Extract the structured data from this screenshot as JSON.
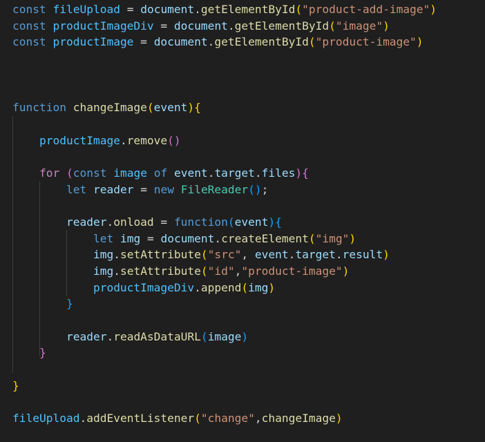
{
  "colors": {
    "background": "#1f1f1f",
    "keyword": "#569cd6",
    "control_keyword": "#c586c0",
    "constant_variable": "#4fc1ff",
    "variable": "#9cdcfe",
    "function": "#dcdcaa",
    "string": "#ce9178",
    "class": "#4ec9b0",
    "bracket_1": "#ffd700",
    "bracket_2": "#da70d6",
    "bracket_3": "#179fff"
  },
  "code": {
    "lines": [
      [
        {
          "t": "const",
          "c": "kw"
        },
        {
          "t": " ",
          "c": "op"
        },
        {
          "t": "fileUpload",
          "c": "var"
        },
        {
          "t": " = ",
          "c": "op"
        },
        {
          "t": "document",
          "c": "prop"
        },
        {
          "t": ".",
          "c": "op"
        },
        {
          "t": "getElementById",
          "c": "fn"
        },
        {
          "t": "(",
          "c": "br1"
        },
        {
          "t": "\"product-add-image\"",
          "c": "str"
        },
        {
          "t": ")",
          "c": "br1"
        }
      ],
      [
        {
          "t": "const",
          "c": "kw"
        },
        {
          "t": " ",
          "c": "op"
        },
        {
          "t": "productImageDiv",
          "c": "var"
        },
        {
          "t": " = ",
          "c": "op"
        },
        {
          "t": "document",
          "c": "prop"
        },
        {
          "t": ".",
          "c": "op"
        },
        {
          "t": "getElementById",
          "c": "fn"
        },
        {
          "t": "(",
          "c": "br1"
        },
        {
          "t": "\"image\"",
          "c": "str"
        },
        {
          "t": ")",
          "c": "br1"
        }
      ],
      [
        {
          "t": "const",
          "c": "kw"
        },
        {
          "t": " ",
          "c": "op"
        },
        {
          "t": "productImage",
          "c": "var"
        },
        {
          "t": " = ",
          "c": "op"
        },
        {
          "t": "document",
          "c": "prop"
        },
        {
          "t": ".",
          "c": "op"
        },
        {
          "t": "getElementById",
          "c": "fn"
        },
        {
          "t": "(",
          "c": "br1"
        },
        {
          "t": "\"product-image\"",
          "c": "str"
        },
        {
          "t": ")",
          "c": "br1"
        }
      ],
      [],
      [],
      [],
      [
        {
          "t": "function",
          "c": "kw"
        },
        {
          "t": " ",
          "c": "op"
        },
        {
          "t": "changeImage",
          "c": "fn"
        },
        {
          "t": "(",
          "c": "br1"
        },
        {
          "t": "event",
          "c": "prop"
        },
        {
          "t": ")",
          "c": "br1"
        },
        {
          "t": "{",
          "c": "br1"
        }
      ],
      [],
      [
        {
          "t": "    ",
          "c": "op"
        },
        {
          "t": "productImage",
          "c": "var"
        },
        {
          "t": ".",
          "c": "op"
        },
        {
          "t": "remove",
          "c": "fn"
        },
        {
          "t": "()",
          "c": "br2"
        }
      ],
      [],
      [
        {
          "t": "    ",
          "c": "op"
        },
        {
          "t": "for",
          "c": "kw2"
        },
        {
          "t": " ",
          "c": "op"
        },
        {
          "t": "(",
          "c": "br2"
        },
        {
          "t": "const",
          "c": "kw"
        },
        {
          "t": " ",
          "c": "op"
        },
        {
          "t": "image",
          "c": "var"
        },
        {
          "t": " ",
          "c": "op"
        },
        {
          "t": "of",
          "c": "kw"
        },
        {
          "t": " ",
          "c": "op"
        },
        {
          "t": "event",
          "c": "prop"
        },
        {
          "t": ".",
          "c": "op"
        },
        {
          "t": "target",
          "c": "prop"
        },
        {
          "t": ".",
          "c": "op"
        },
        {
          "t": "files",
          "c": "prop"
        },
        {
          "t": ")",
          "c": "br2"
        },
        {
          "t": "{",
          "c": "br2"
        }
      ],
      [
        {
          "t": "        ",
          "c": "op"
        },
        {
          "t": "let",
          "c": "kw"
        },
        {
          "t": " ",
          "c": "op"
        },
        {
          "t": "reader",
          "c": "prop"
        },
        {
          "t": " = ",
          "c": "op"
        },
        {
          "t": "new",
          "c": "kw"
        },
        {
          "t": " ",
          "c": "op"
        },
        {
          "t": "FileReader",
          "c": "cls"
        },
        {
          "t": "()",
          "c": "br3"
        },
        {
          "t": ";",
          "c": "op"
        }
      ],
      [],
      [
        {
          "t": "        ",
          "c": "op"
        },
        {
          "t": "reader",
          "c": "prop"
        },
        {
          "t": ".",
          "c": "op"
        },
        {
          "t": "onload",
          "c": "fn"
        },
        {
          "t": " = ",
          "c": "op"
        },
        {
          "t": "function",
          "c": "kw"
        },
        {
          "t": "(",
          "c": "br3"
        },
        {
          "t": "event",
          "c": "prop"
        },
        {
          "t": ")",
          "c": "br3"
        },
        {
          "t": "{",
          "c": "br3"
        }
      ],
      [
        {
          "t": "            ",
          "c": "op"
        },
        {
          "t": "let",
          "c": "kw"
        },
        {
          "t": " ",
          "c": "op"
        },
        {
          "t": "img",
          "c": "prop"
        },
        {
          "t": " = ",
          "c": "op"
        },
        {
          "t": "document",
          "c": "prop"
        },
        {
          "t": ".",
          "c": "op"
        },
        {
          "t": "createElement",
          "c": "fn"
        },
        {
          "t": "(",
          "c": "br1"
        },
        {
          "t": "\"img\"",
          "c": "str"
        },
        {
          "t": ")",
          "c": "br1"
        }
      ],
      [
        {
          "t": "            ",
          "c": "op"
        },
        {
          "t": "img",
          "c": "prop"
        },
        {
          "t": ".",
          "c": "op"
        },
        {
          "t": "setAttribute",
          "c": "fn"
        },
        {
          "t": "(",
          "c": "br1"
        },
        {
          "t": "\"src\"",
          "c": "str"
        },
        {
          "t": ", ",
          "c": "op"
        },
        {
          "t": "event",
          "c": "prop"
        },
        {
          "t": ".",
          "c": "op"
        },
        {
          "t": "target",
          "c": "prop"
        },
        {
          "t": ".",
          "c": "op"
        },
        {
          "t": "result",
          "c": "prop"
        },
        {
          "t": ")",
          "c": "br1"
        }
      ],
      [
        {
          "t": "            ",
          "c": "op"
        },
        {
          "t": "img",
          "c": "prop"
        },
        {
          "t": ".",
          "c": "op"
        },
        {
          "t": "setAttribute",
          "c": "fn"
        },
        {
          "t": "(",
          "c": "br1"
        },
        {
          "t": "\"id\"",
          "c": "str"
        },
        {
          "t": ",",
          "c": "op"
        },
        {
          "t": "\"product-image\"",
          "c": "str"
        },
        {
          "t": ")",
          "c": "br1"
        }
      ],
      [
        {
          "t": "            ",
          "c": "op"
        },
        {
          "t": "productImageDiv",
          "c": "var"
        },
        {
          "t": ".",
          "c": "op"
        },
        {
          "t": "append",
          "c": "fn"
        },
        {
          "t": "(",
          "c": "br1"
        },
        {
          "t": "img",
          "c": "prop"
        },
        {
          "t": ")",
          "c": "br1"
        }
      ],
      [
        {
          "t": "        ",
          "c": "op"
        },
        {
          "t": "}",
          "c": "br3"
        }
      ],
      [],
      [
        {
          "t": "        ",
          "c": "op"
        },
        {
          "t": "reader",
          "c": "prop"
        },
        {
          "t": ".",
          "c": "op"
        },
        {
          "t": "readAsDataURL",
          "c": "fn"
        },
        {
          "t": "(",
          "c": "br3"
        },
        {
          "t": "image",
          "c": "prop"
        },
        {
          "t": ")",
          "c": "br3"
        }
      ],
      [
        {
          "t": "    ",
          "c": "op"
        },
        {
          "t": "}",
          "c": "br2"
        }
      ],
      [],
      [
        {
          "t": "}",
          "c": "br1"
        }
      ],
      [],
      [
        {
          "t": "fileUpload",
          "c": "var"
        },
        {
          "t": ".",
          "c": "op"
        },
        {
          "t": "addEventListener",
          "c": "fn"
        },
        {
          "t": "(",
          "c": "br1"
        },
        {
          "t": "\"change\"",
          "c": "str"
        },
        {
          "t": ",",
          "c": "op"
        },
        {
          "t": "changeImage",
          "c": "fn"
        },
        {
          "t": ")",
          "c": "br1"
        }
      ]
    ]
  }
}
